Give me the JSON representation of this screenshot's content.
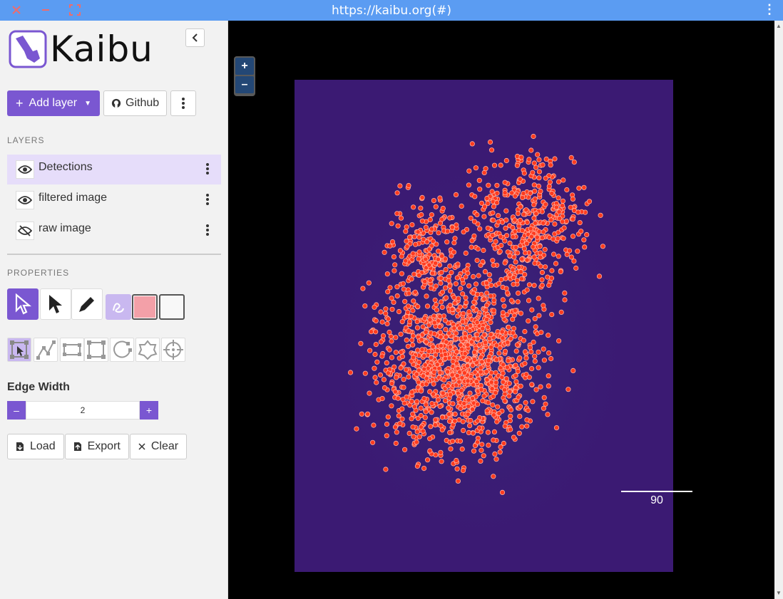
{
  "window": {
    "url": "https://kaibu.org(#)",
    "controls": [
      "close-icon",
      "minimize-icon",
      "maximize-icon"
    ]
  },
  "app": {
    "name": "Kaibu"
  },
  "toolbar": {
    "add_layer_label": "Add layer",
    "github_label": "Github"
  },
  "layers": {
    "section_label": "LAYERS",
    "items": [
      {
        "label": "Detections",
        "visible": true,
        "active": true
      },
      {
        "label": "filtered image",
        "visible": true,
        "active": false
      },
      {
        "label": "raw image",
        "visible": false,
        "active": false
      }
    ]
  },
  "properties": {
    "section_label": "PROPERTIES",
    "colors": {
      "fill": "#f3a0a8",
      "stroke": "#ffffff"
    },
    "edge_width_label": "Edge Width",
    "edge_width_value": "2"
  },
  "actions": {
    "load_label": "Load",
    "export_label": "Export",
    "clear_label": "Clear"
  },
  "viewer": {
    "zoom_in": "+",
    "zoom_out": "–",
    "scale_bar_label": "90",
    "accent": "#7a57d1",
    "image_bg": "#3b1a73",
    "detection_color": "#ff3b1f"
  }
}
